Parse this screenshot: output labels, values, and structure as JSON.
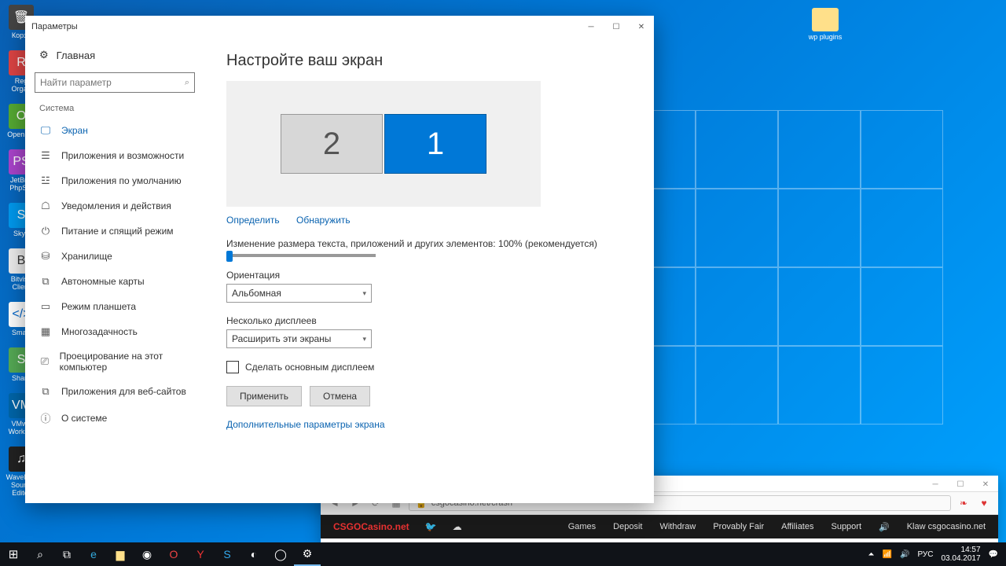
{
  "window": {
    "title": "Параметры"
  },
  "sidebar": {
    "home": "Главная",
    "search_placeholder": "Найти параметр",
    "section": "Система",
    "items": [
      {
        "label": "Экран"
      },
      {
        "label": "Приложения и возможности"
      },
      {
        "label": "Приложения по умолчанию"
      },
      {
        "label": "Уведомления и действия"
      },
      {
        "label": "Питание и спящий режим"
      },
      {
        "label": "Хранилище"
      },
      {
        "label": "Автономные карты"
      },
      {
        "label": "Режим планшета"
      },
      {
        "label": "Многозадачность"
      },
      {
        "label": "Проецирование на этот компьютер"
      },
      {
        "label": "Приложения для веб-сайтов"
      },
      {
        "label": "О системе"
      }
    ]
  },
  "content": {
    "heading": "Настройте ваш экран",
    "mon1": "1",
    "mon2": "2",
    "identify": "Определить",
    "detect": "Обнаружить",
    "scale_label": "Изменение размера текста, приложений и других элементов: 100% (рекомендуется)",
    "orientation_label": "Ориентация",
    "orientation_value": "Альбомная",
    "multi_label": "Несколько дисплеев",
    "multi_value": "Расширить эти экраны",
    "checkbox": "Сделать основным дисплеем",
    "apply": "Применить",
    "cancel": "Отмена",
    "advanced": "Дополнительные параметры экрана"
  },
  "desktop": {
    "icons": [
      "Корзи",
      "Reg Organ",
      "Open Se",
      "JetBrai PhpSto",
      "Skyp",
      "Bitvise Client",
      "Smart",
      "Share",
      "VMwa Worksta",
      "WavePad Sound Editor"
    ],
    "wp": "wp plugins"
  },
  "browser": {
    "url": "csgocasino.net/crash",
    "logo": "CSGOCasino.net",
    "menu": [
      "Games",
      "Deposit",
      "Withdraw",
      "Provably Fair",
      "Affiliates",
      "Support"
    ],
    "user": "Klaw csgocasino.net"
  },
  "tray": {
    "lang": "РУС",
    "time": "14:57",
    "date": "03.04.2017"
  }
}
